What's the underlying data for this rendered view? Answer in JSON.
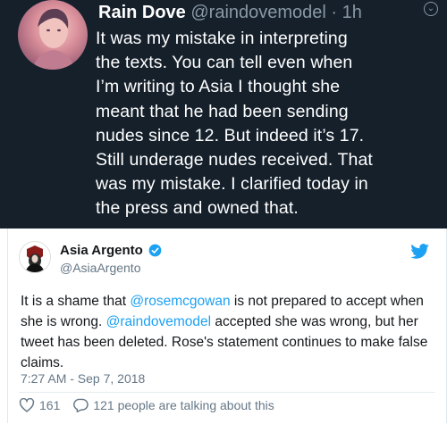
{
  "embedded_tweet": {
    "display_name": "Rain Dove",
    "handle_time": " @raindovemodel · 1h",
    "text": "It was my mistake in interpreting\nthe texts. You can tell even when\nI’m writing to Asia I thought she\nmeant that he had been sending\nnudes since 12. But indeed it’s 17.\nStill underage nudes received. That\nwas my mistake. I clarified today in\nthe press and owned that."
  },
  "tweet": {
    "display_name": "Asia Argento",
    "handle": "@AsiaArgento",
    "text_parts": {
      "p1": "It is a shame that ",
      "mention1": "@rosemcgowan",
      "p2": " is not prepared to accept when she is wrong. ",
      "mention2": "@raindovemodel",
      "p3": " accepted she was wrong, but her tweet has been deleted. Rose's statement continues to make false claims."
    },
    "timestamp": "7:27 AM - Sep 7, 2018",
    "likes": "161",
    "talking": "121 people are talking about this"
  },
  "colors": {
    "dark_bg": "#15202b",
    "twitter_blue": "#1da1f2",
    "muted": "#657786"
  },
  "icons": [
    "more-options-icon",
    "verified-badge-icon",
    "twitter-bird-icon",
    "heart-icon",
    "comment-bubble-icon"
  ]
}
